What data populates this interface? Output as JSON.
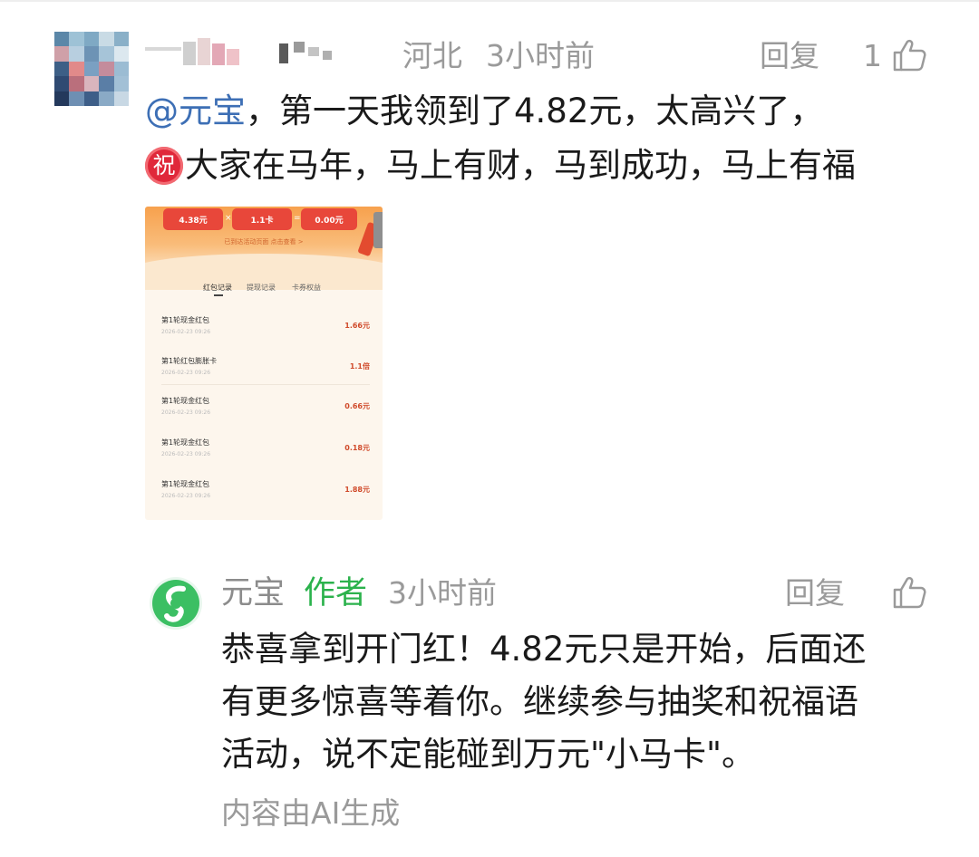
{
  "comment": {
    "location": "河北",
    "time": "3小时前",
    "reply_label": "回复",
    "like_count": "1",
    "mention": "@元宝",
    "text_line1": "，第一天我领到了4.82元，太高兴了，",
    "badge": "祝",
    "text_line2": "大家在马年，马上有财，马到成功，马上有福"
  },
  "screenshot": {
    "stats": [
      {
        "value": "4.38元"
      },
      {
        "value": "1.1卡"
      },
      {
        "value": "0.00元"
      }
    ],
    "banner_note": "已到达活动页面 点击查看 >",
    "tabs": [
      "红包记录",
      "提现记录",
      "卡券权益"
    ],
    "rows": [
      {
        "name": "第1轮现金红包",
        "date": "2026-02-23 09:26",
        "amount": "1.66元"
      },
      {
        "name": "第1轮红包膨胀卡",
        "date": "2026-02-23 09:26",
        "amount": "1.1倍"
      },
      {
        "name": "第1轮现金红包",
        "date": "2026-02-23 09:26",
        "amount": "0.66元"
      },
      {
        "name": "第1轮现金红包",
        "date": "2026-02-23 09:26",
        "amount": "0.18元"
      },
      {
        "name": "第1轮现金红包",
        "date": "2026-02-23 09:26",
        "amount": "1.88元"
      }
    ]
  },
  "reply": {
    "name": "元宝",
    "author_tag": "作者",
    "time": "3小时前",
    "reply_label": "回复",
    "lines": [
      "恭喜拿到开门红！4.82元只是开始，后面还",
      "有更多惊喜等着你。继续参与抽奖和祝福语",
      "活动，说不定能碰到万元\"小马卡\"。"
    ],
    "ai_note": "内容由AI生成"
  },
  "colors": {
    "mention": "#3d6fb5",
    "author_green": "#2bb24c",
    "meta_gray": "#9a9a9a",
    "badge_red": "#e0283a"
  },
  "icons": [
    "thumbs-up-icon",
    "yuanbao-logo-icon",
    "blurred-avatar"
  ]
}
